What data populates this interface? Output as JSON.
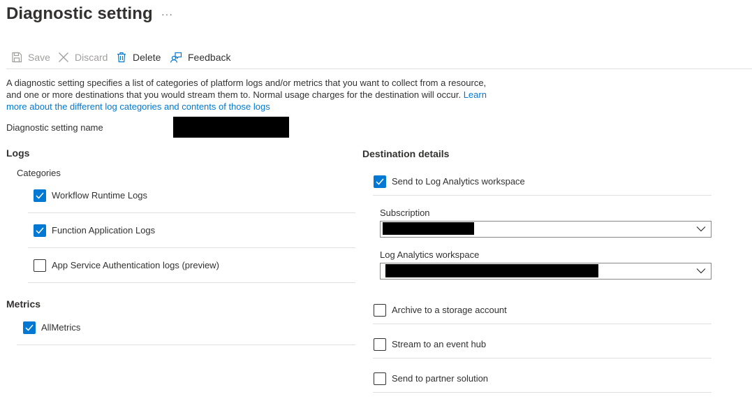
{
  "header": {
    "title": "Diagnostic setting",
    "more": "···"
  },
  "toolbar": {
    "save_label": "Save",
    "discard_label": "Discard",
    "delete_label": "Delete",
    "feedback_label": "Feedback"
  },
  "description": {
    "text": "A diagnostic setting specifies a list of categories of platform logs and/or metrics that you want to collect from a resource, and one or more destinations that you would stream them to. Normal usage charges for the destination will occur. ",
    "link": "Learn more about the different log categories and contents of those logs"
  },
  "setting_name": {
    "label": "Diagnostic setting name"
  },
  "logs": {
    "heading": "Logs",
    "categories_label": "Categories",
    "items": [
      {
        "label": "Workflow Runtime Logs",
        "checked": true
      },
      {
        "label": "Function Application Logs",
        "checked": true
      },
      {
        "label": "App Service Authentication logs (preview)",
        "checked": false
      }
    ]
  },
  "metrics": {
    "heading": "Metrics",
    "items": [
      {
        "label": "AllMetrics",
        "checked": true
      }
    ]
  },
  "destination": {
    "heading": "Destination details",
    "log_analytics": {
      "label": "Send to Log Analytics workspace",
      "checked": true
    },
    "subscription_label": "Subscription",
    "workspace_label": "Log Analytics workspace",
    "others": [
      {
        "label": "Archive to a storage account",
        "checked": false
      },
      {
        "label": "Stream to an event hub",
        "checked": false
      },
      {
        "label": "Send to partner solution",
        "checked": false
      }
    ]
  },
  "colors": {
    "accent": "#0078d4",
    "text": "#323130",
    "disabled": "#a19f9d",
    "divider": "#e1dfdd"
  }
}
